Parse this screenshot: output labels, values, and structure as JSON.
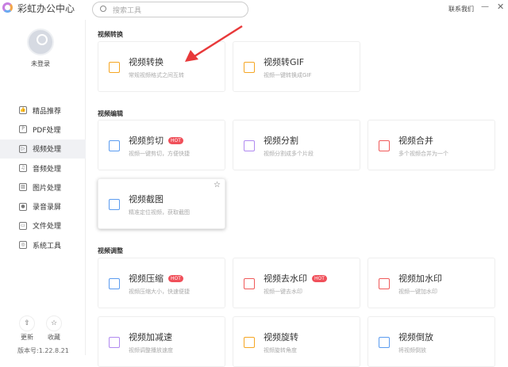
{
  "header": {
    "app_name": "彩虹办公中心",
    "search_placeholder": "搜索工具",
    "contact": "联系我们",
    "minimize": "—",
    "close": "✕"
  },
  "user": {
    "status": "未登录"
  },
  "sidebar": {
    "items": [
      {
        "label": "精品推荐",
        "icon": "👍"
      },
      {
        "label": "PDF处理",
        "icon": "P"
      },
      {
        "label": "视频处理",
        "icon": "▷"
      },
      {
        "label": "音频处理",
        "icon": "♫"
      },
      {
        "label": "图片处理",
        "icon": "▨"
      },
      {
        "label": "录音录屏",
        "icon": "●"
      },
      {
        "label": "文件处理",
        "icon": "▭"
      },
      {
        "label": "系统工具",
        "icon": "◎"
      }
    ],
    "active": "视频处理",
    "update": "更新",
    "favorite": "收藏",
    "version": "版本号:1.22.8.21"
  },
  "sections": [
    {
      "title": "视频转换",
      "cards": [
        {
          "title": "视频转换",
          "desc": "常规视频格式之间互转",
          "color": "#f5a623"
        },
        {
          "title": "视频转GIF",
          "desc": "视频一键转换成GIF",
          "color": "#f5a623"
        }
      ]
    },
    {
      "title": "视频编辑",
      "cards": [
        {
          "title": "视频剪切",
          "hot": "HOT",
          "desc": "视频一键剪切，方便快捷",
          "color": "#5b9cf0"
        },
        {
          "title": "视频分割",
          "desc": "视频分割成多个片段",
          "color": "#b18af0"
        },
        {
          "title": "视频合并",
          "desc": "多个视频合并为一个",
          "color": "#f05a5a"
        },
        {
          "title": "视频截图",
          "desc": "精准定位视频，获取截图",
          "color": "#5b9cf0"
        }
      ]
    },
    {
      "title": "视频调整",
      "cards": [
        {
          "title": "视频压缩",
          "hot": "HOT",
          "desc": "视频压缩大小，快速便捷",
          "color": "#5b9cf0"
        },
        {
          "title": "视频去水印",
          "hot": "HOT",
          "desc": "视频一键去水印",
          "color": "#f05a5a"
        },
        {
          "title": "视频加水印",
          "desc": "视频一键加水印",
          "color": "#f05a5a"
        },
        {
          "title": "视频加减速",
          "desc": "视频调整播放速度",
          "color": "#b18af0"
        },
        {
          "title": "视频旋转",
          "desc": "视频旋转角度",
          "color": "#f5a623"
        },
        {
          "title": "视频倒放",
          "desc": "将视频倒放",
          "color": "#5b9cf0"
        }
      ]
    }
  ],
  "favorite_star": "☆"
}
